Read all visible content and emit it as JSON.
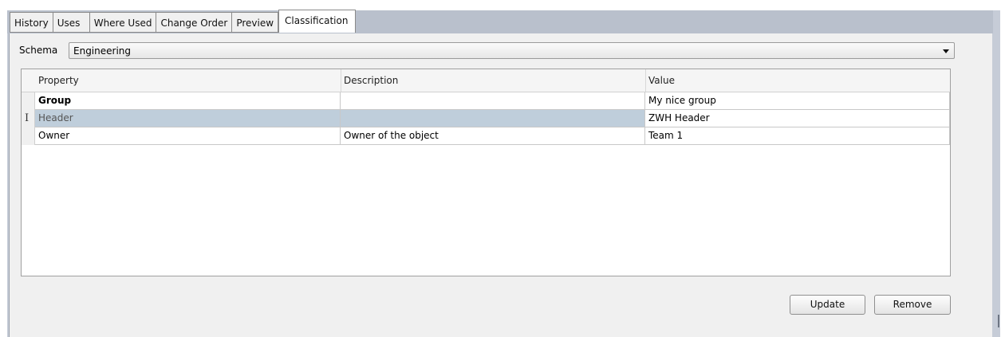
{
  "tabs": [
    {
      "label": "History"
    },
    {
      "label": "Uses"
    },
    {
      "label": "Where Used"
    },
    {
      "label": "Change Order"
    },
    {
      "label": "Preview"
    },
    {
      "label": "Classification",
      "active": true
    }
  ],
  "schema": {
    "label": "Schema",
    "value": "Engineering"
  },
  "grid": {
    "columns": [
      "Property",
      "Description",
      "Value"
    ],
    "rows": [
      {
        "property": "Group",
        "description": "",
        "value": "My nice group",
        "bold": true
      },
      {
        "property": "Header",
        "description": "",
        "value": "ZWH Header",
        "selected": true,
        "cursor": "I"
      },
      {
        "property": "Owner",
        "description": "Owner of the object",
        "value": "Team 1"
      }
    ]
  },
  "buttons": {
    "update": "Update",
    "remove": "Remove"
  },
  "colors": {
    "frame": "#c6ccd7",
    "panel": "#f0f0f0",
    "selected_row": "#bfcedb"
  }
}
